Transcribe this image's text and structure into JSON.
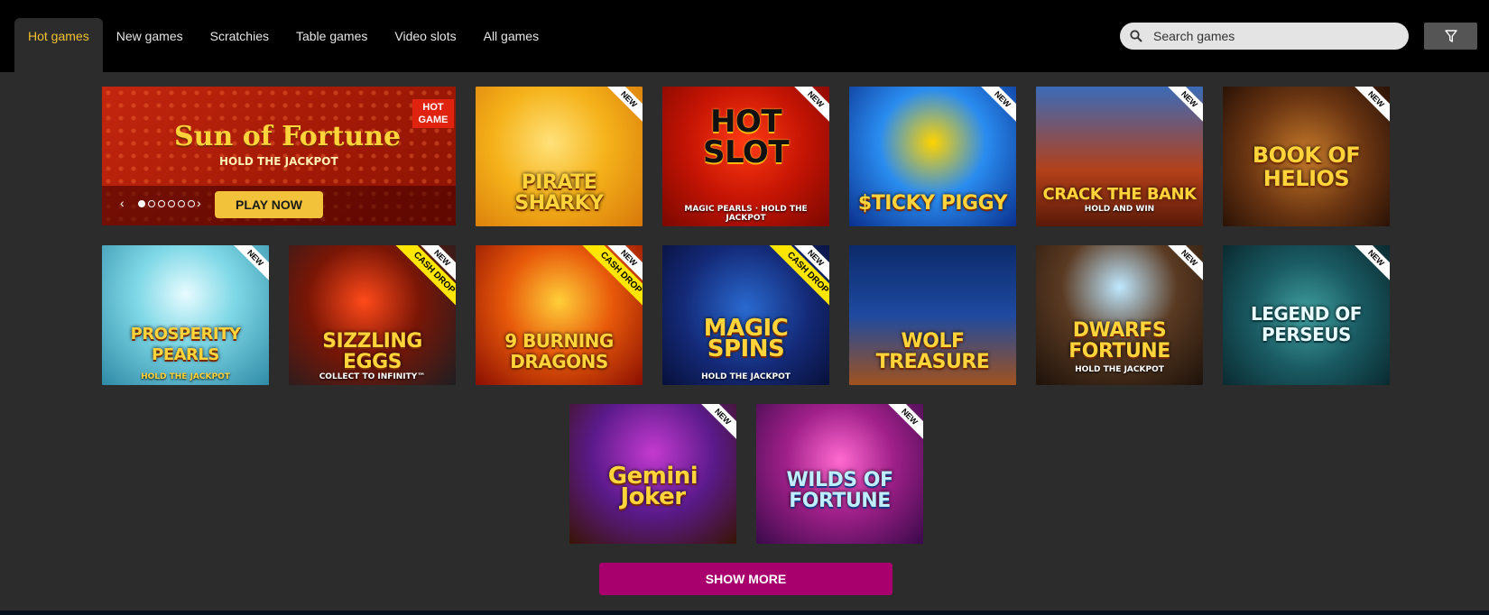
{
  "nav": {
    "tabs": [
      {
        "label": "Hot games",
        "active": true
      },
      {
        "label": "New games"
      },
      {
        "label": "Scratchies"
      },
      {
        "label": "Table games"
      },
      {
        "label": "Video slots"
      },
      {
        "label": "All games"
      }
    ],
    "search_placeholder": "Search games",
    "filter_icon": "filter-icon"
  },
  "banner": {
    "title": "Sun of Fortune",
    "subtitle": "HOLD THE JACKPOT",
    "badge": "HOT GAME",
    "cta": "PLAY NOW",
    "prev": "‹",
    "next": "›",
    "slides": 6,
    "active_slide": 1
  },
  "games": [
    {
      "title": "PIRATE SHARKY",
      "sub": "",
      "new": "NEW",
      "cash": ""
    },
    {
      "title": "HOT SLOT",
      "sub": "MAGIC PEARLS · HOLD THE JACKPOT",
      "new": "NEW",
      "cash": ""
    },
    {
      "title": "$TICKY PIGGY",
      "sub": "",
      "new": "NEW",
      "cash": ""
    },
    {
      "title": "CRACK THE BANK",
      "sub": "HOLD AND WIN",
      "new": "NEW",
      "cash": ""
    },
    {
      "title": "BOOK OF HELIOS",
      "sub": "",
      "new": "NEW",
      "cash": ""
    },
    {
      "title": "PROSPERITY PEARLS",
      "sub": "HOLD THE JACKPOT",
      "new": "NEW",
      "cash": ""
    },
    {
      "title": "SIZZLING EGGS",
      "sub": "COLLECT TO INFINITY™",
      "new": "NEW",
      "cash": "CASH DROP"
    },
    {
      "title": "9 BURNING DRAGONS",
      "sub": "",
      "new": "NEW",
      "cash": "CASH DROP"
    },
    {
      "title": "MAGIC SPINS",
      "sub": "HOLD THE JACKPOT",
      "new": "NEW",
      "cash": "CASH DROP"
    },
    {
      "title": "WOLF TREASURE",
      "sub": "",
      "new": "",
      "cash": ""
    },
    {
      "title": "DWARFS FORTUNE",
      "sub": "HOLD THE JACKPOT",
      "new": "NEW",
      "cash": ""
    },
    {
      "title": "LEGEND OF PERSEUS",
      "sub": "",
      "new": "NEW",
      "cash": ""
    },
    {
      "title": "Gemini Joker",
      "sub": "",
      "new": "NEW",
      "cash": ""
    },
    {
      "title": "WILDS OF FORTUNE",
      "sub": "",
      "new": "NEW",
      "cash": ""
    }
  ],
  "show_more": "SHOW MORE",
  "colors": {
    "active_tab": "#f2c230",
    "play_button": "#f2c23a",
    "show_more": "#a8006c",
    "hot_badge": "#e0230f",
    "cash_ribbon": "#ffe600"
  }
}
